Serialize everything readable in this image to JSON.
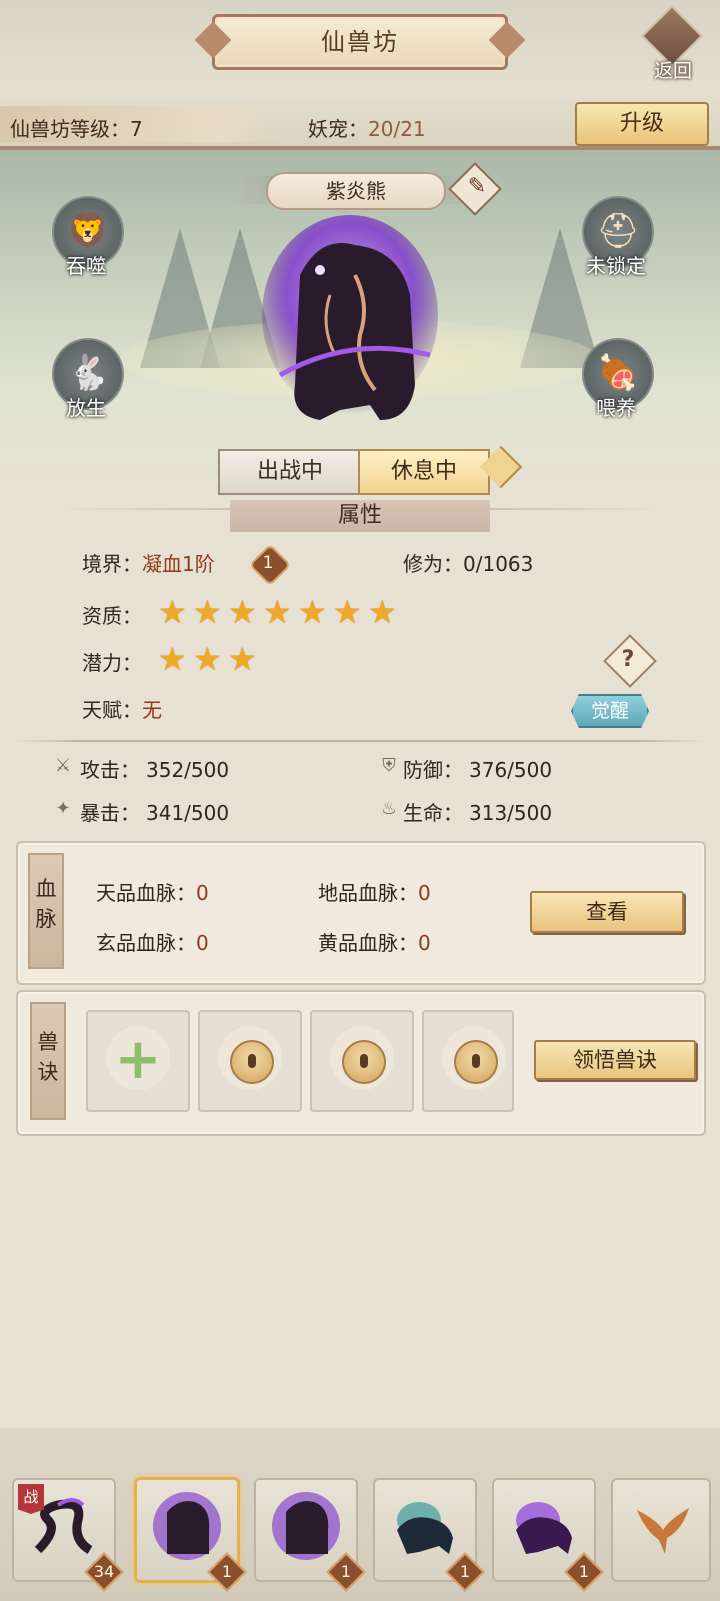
{
  "header": {
    "title": "仙兽坊",
    "back_label": "返回"
  },
  "info_bar": {
    "level_label": "仙兽坊等级：",
    "level_value": "7",
    "pet_label": "妖宠：",
    "pet_value": "20/21",
    "upgrade_label": "升级"
  },
  "pet": {
    "name": "紫炎熊"
  },
  "actions": {
    "devour": "吞噬",
    "lock": "未锁定",
    "release": "放生",
    "feed": "喂养"
  },
  "toggle": {
    "in_battle": "出战中",
    "resting": "休息中"
  },
  "attributes": {
    "section_title": "属性",
    "realm_label": "境界：",
    "realm_value": "凝血1阶",
    "realm_badge": "1",
    "cultivation_label": "修为：",
    "cultivation_value": "0/1063",
    "aptitude_label": "资质：",
    "aptitude_stars": 7,
    "potential_label": "潜力：",
    "potential_stars": 3,
    "talent_label": "天赋：",
    "talent_value": "无",
    "help_label": "?",
    "awaken_label": "觉醒"
  },
  "stats": {
    "attack_label": "攻击：",
    "attack_value": "352/500",
    "defense_label": "防御：",
    "defense_value": "376/500",
    "crit_label": "暴击：",
    "crit_value": "341/500",
    "life_label": "生命：",
    "life_value": "313/500"
  },
  "bloodline": {
    "section_label_1": "血",
    "section_label_2": "脉",
    "heaven_label": "天品血脉：",
    "heaven_value": "0",
    "earth_label": "地品血脉：",
    "earth_value": "0",
    "mystic_label": "玄品血脉：",
    "mystic_value": "0",
    "yellow_label": "黄品血脉：",
    "yellow_value": "0",
    "view_label": "查看"
  },
  "skills": {
    "section_label_1": "兽",
    "section_label_2": "诀",
    "comprehend_label": "领悟兽诀"
  },
  "pet_list": {
    "battle_tag": "战",
    "levels": [
      "34",
      "1",
      "1",
      "1",
      "1"
    ]
  },
  "colors": {
    "accent_gold": "#e9c47a",
    "star": "#f0a828",
    "realm_red": "#8f3a1c",
    "awaken_teal": "#5ea7b8"
  }
}
